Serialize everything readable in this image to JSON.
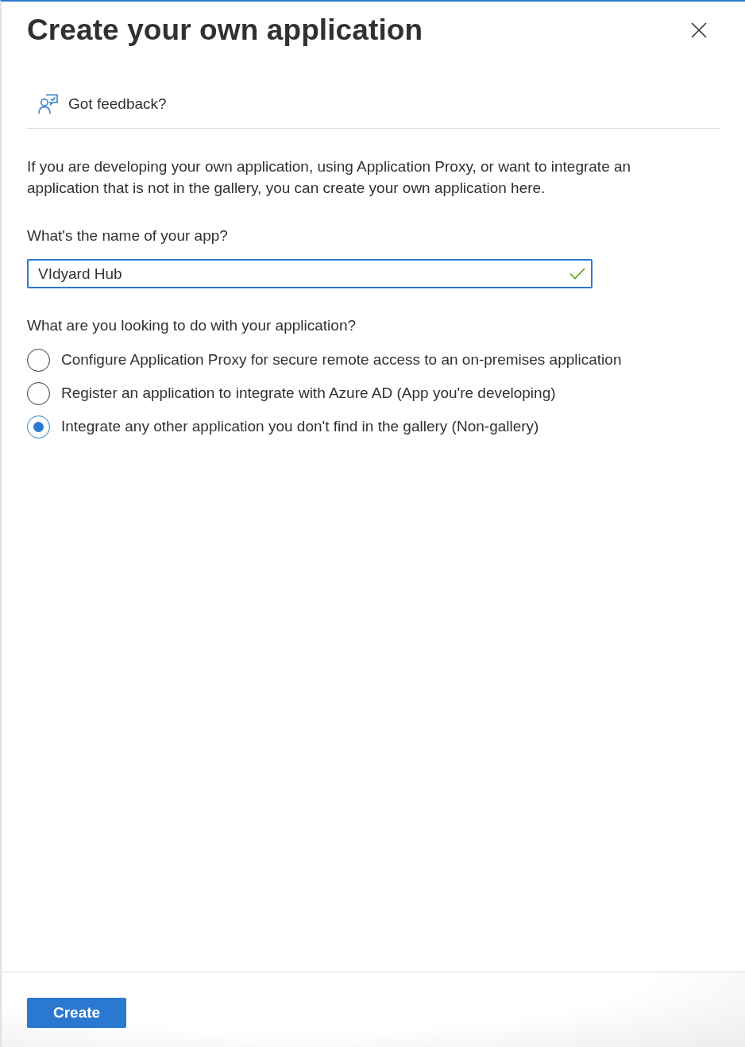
{
  "panel": {
    "title": "Create your own application"
  },
  "feedback": {
    "label": "Got feedback?"
  },
  "intro": "If you are developing your own application, using Application Proxy, or want to integrate an application that is not in the gallery, you can create your own application here.",
  "name_field": {
    "label": "What's the name of your app?",
    "value": "VIdyard Hub",
    "valid": true
  },
  "purpose": {
    "label": "What are you looking to do with your application?",
    "options": [
      {
        "label": "Configure Application Proxy for secure remote access to an on-premises application",
        "selected": false
      },
      {
        "label": "Register an application to integrate with Azure AD (App you're developing)",
        "selected": false
      },
      {
        "label": "Integrate any other application you don't find in the gallery (Non-gallery)",
        "selected": true
      }
    ]
  },
  "footer": {
    "buttons": [
      {
        "label": "Create",
        "kind": "primary"
      }
    ]
  }
}
